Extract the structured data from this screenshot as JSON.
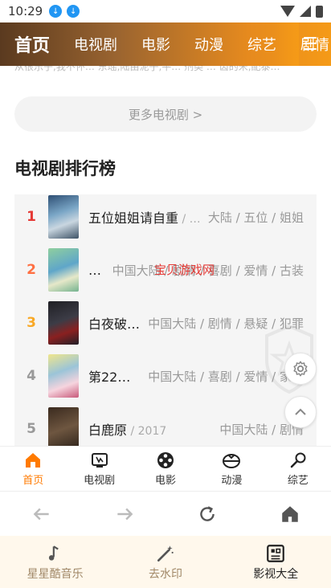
{
  "status": {
    "time": "10:29"
  },
  "top_tabs": [
    "首页",
    "电视剧",
    "电影",
    "动漫",
    "综艺",
    "剧情"
  ],
  "clipped_text": "从很乐子,我不怀…  东瑶,陆由泥子,平…  剂类 … 齿的米,配泰…",
  "more_button": "更多电视剧 >",
  "section_title": "电视剧排行榜",
  "ranking": [
    {
      "rank": "1",
      "name": "五位姐姐请自重",
      "year": " / …",
      "tags": "大陆 / 五位 / 姐姐",
      "rank_color": "#e53935"
    },
    {
      "rank": "2",
      "name": "…",
      "year": "",
      "tags": "中国大陆 / 剧情 / 喜剧 / 爱情 / 古装",
      "rank_color": "#ff7043"
    },
    {
      "rank": "3",
      "name": "白夜破…",
      "year": "",
      "tags": "中国大陆 / 剧情 / 悬疑 / 犯罪",
      "rank_color": "#f9a825"
    },
    {
      "rank": "4",
      "name": "第22…",
      "year": "",
      "tags": "中国大陆 / 喜剧 / 爱情 / 家庭",
      "rank_color": "#999999"
    },
    {
      "rank": "5",
      "name": "白鹿原",
      "year": " / 2017",
      "tags": "中国大陆 / 剧情",
      "rank_color": "#999999"
    }
  ],
  "watermark": "宝贝游戏网",
  "bottom_tabs": [
    "首页",
    "电视剧",
    "电影",
    "动漫",
    "综艺"
  ],
  "app_tabs": [
    "星星酷音乐",
    "去水印",
    "影视大全"
  ],
  "colors": {
    "accent": "#ff7a00",
    "nav_start": "#5a3a1f",
    "nav_end": "#f59a17"
  }
}
